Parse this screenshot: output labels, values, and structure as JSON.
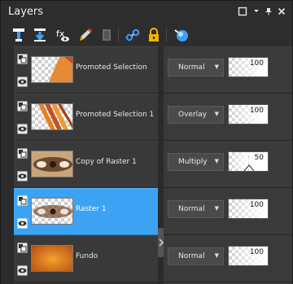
{
  "panel": {
    "title": "Layers"
  },
  "window_controls": [
    "restore-icon",
    "dropdown-icon",
    "pin-icon",
    "close-icon"
  ],
  "toolbar": [
    "new-raster-layer-icon",
    "new-vector-layer-icon",
    "visibility-toggle-icon",
    "edit-layer-icon",
    "delete-layer-icon",
    "link-icon",
    "lock-icon",
    "mask-icon"
  ],
  "layers": [
    {
      "name": "Promoted Selection",
      "blend": "Normal",
      "opacity": "100",
      "selected": false
    },
    {
      "name": "Promoted Selection 1",
      "blend": "Overlay",
      "opacity": "100",
      "selected": false
    },
    {
      "name": "Copy of Raster 1",
      "blend": "Multiply",
      "opacity": "50",
      "selected": false
    },
    {
      "name": "Raster 1",
      "blend": "Normal",
      "opacity": "100",
      "selected": true
    },
    {
      "name": "Fundo",
      "blend": "Normal",
      "opacity": "100",
      "selected": false
    }
  ],
  "colors": {
    "selection": "#3ba3f1",
    "lock": "#f0b400",
    "accent_blue": "#39a0ff"
  }
}
